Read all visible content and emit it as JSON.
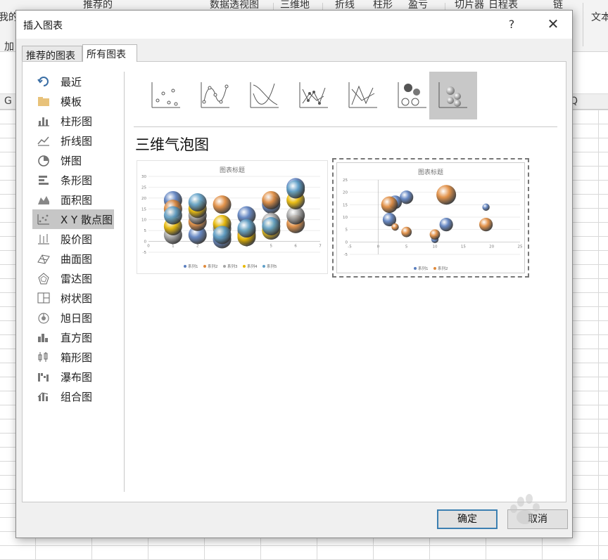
{
  "excel": {
    "ribbon_items": [
      "我的",
      "加",
      "推荐的",
      "数据透视图",
      "三维地",
      "折线",
      "柱形",
      "盈亏",
      "切片器",
      "日程表",
      "链",
      "文本"
    ],
    "column_letters": [
      "G",
      "Q"
    ]
  },
  "dialog": {
    "title": "插入图表",
    "help_glyph": "?",
    "close_glyph": "✕",
    "tabs": [
      {
        "label": "推荐的图表",
        "active": false
      },
      {
        "label": "所有图表",
        "active": true
      }
    ],
    "sidebar": [
      {
        "label": "最近",
        "icon": "recent-icon"
      },
      {
        "label": "模板",
        "icon": "folder-icon"
      },
      {
        "label": "柱形图",
        "icon": "column-chart-icon"
      },
      {
        "label": "折线图",
        "icon": "line-chart-icon"
      },
      {
        "label": "饼图",
        "icon": "pie-chart-icon"
      },
      {
        "label": "条形图",
        "icon": "bar-chart-icon"
      },
      {
        "label": "面积图",
        "icon": "area-chart-icon"
      },
      {
        "label": "X Y 散点图",
        "icon": "scatter-chart-icon",
        "selected": true
      },
      {
        "label": "股价图",
        "icon": "stock-chart-icon"
      },
      {
        "label": "曲面图",
        "icon": "surface-chart-icon"
      },
      {
        "label": "雷达图",
        "icon": "radar-chart-icon"
      },
      {
        "label": "树状图",
        "icon": "treemap-icon"
      },
      {
        "label": "旭日图",
        "icon": "sunburst-icon"
      },
      {
        "label": "直方图",
        "icon": "histogram-icon"
      },
      {
        "label": "箱形图",
        "icon": "box-whisker-icon"
      },
      {
        "label": "瀑布图",
        "icon": "waterfall-icon"
      },
      {
        "label": "组合图",
        "icon": "combo-chart-icon"
      }
    ],
    "chart_subtypes": [
      {
        "name": "scatter-icon"
      },
      {
        "name": "scatter-smooth-markers-icon"
      },
      {
        "name": "scatter-smooth-icon"
      },
      {
        "name": "scatter-straight-markers-icon"
      },
      {
        "name": "scatter-straight-icon"
      },
      {
        "name": "bubble-icon"
      },
      {
        "name": "bubble-3d-icon",
        "selected": true
      }
    ],
    "subtype_title": "三维气泡图",
    "ok_label": "确定",
    "cancel_label": "取消"
  },
  "chart_data": [
    {
      "type": "scatter",
      "subtype": "bubble-3d",
      "title": "图表标题",
      "xlim": [
        0,
        7
      ],
      "ylim": [
        -5,
        30
      ],
      "x_ticks": [
        "0",
        "1",
        "2",
        "3",
        "4",
        "5",
        "6",
        "7"
      ],
      "y_ticks": [
        "-5",
        "0",
        "5",
        "10",
        "15",
        "20",
        "25",
        "30"
      ],
      "legend": [
        "系列1",
        "系列2",
        "系列3",
        "系列4",
        "系列5"
      ],
      "legend_position": "bottom",
      "series_colors": [
        "#5b7fbf",
        "#e08a3c",
        "#a5a5a5",
        "#e8b800",
        "#5fa0c8"
      ],
      "series": [
        {
          "name": "系列1",
          "x": [
            1,
            2,
            3,
            4,
            5,
            6
          ],
          "y": [
            19,
            3,
            1,
            12,
            17,
            25
          ]
        },
        {
          "name": "系列2",
          "x": [
            1,
            2,
            3,
            4,
            5,
            6
          ],
          "y": [
            15,
            9,
            17,
            3,
            19,
            8
          ]
        },
        {
          "name": "系列3",
          "x": [
            1,
            2,
            3,
            4,
            5,
            6
          ],
          "y": [
            3,
            12,
            6,
            5,
            9,
            12
          ]
        },
        {
          "name": "系列4",
          "x": [
            1,
            2,
            3,
            4,
            5,
            6
          ],
          "y": [
            7,
            15,
            8,
            2,
            5,
            19
          ]
        },
        {
          "name": "系列5",
          "x": [
            1,
            2,
            3,
            4,
            5,
            6
          ],
          "y": [
            12,
            18,
            3,
            6,
            7,
            24
          ]
        }
      ]
    },
    {
      "type": "scatter",
      "subtype": "bubble-3d",
      "title": "图表标题",
      "xlim": [
        -5,
        25
      ],
      "ylim": [
        -5,
        25
      ],
      "x_ticks": [
        "-5",
        "0",
        "5",
        "10",
        "15",
        "20",
        "25"
      ],
      "y_ticks": [
        "-5",
        "0",
        "5",
        "10",
        "15",
        "20",
        "25"
      ],
      "legend": [
        "系列1",
        "系列2"
      ],
      "legend_position": "bottom",
      "series_colors": [
        "#5b7fbf",
        "#e08a3c"
      ],
      "series": [
        {
          "name": "系列1",
          "x": [
            2,
            3,
            5,
            10,
            12,
            19
          ],
          "y": [
            9,
            16,
            18,
            1,
            7,
            14
          ],
          "size": [
            3,
            3,
            3,
            1,
            3,
            1
          ]
        },
        {
          "name": "系列2",
          "x": [
            2,
            3,
            5,
            10,
            12,
            19
          ],
          "y": [
            15,
            6,
            4,
            3,
            19,
            7
          ],
          "size": [
            4,
            1,
            2,
            2,
            5,
            3
          ]
        }
      ]
    }
  ]
}
